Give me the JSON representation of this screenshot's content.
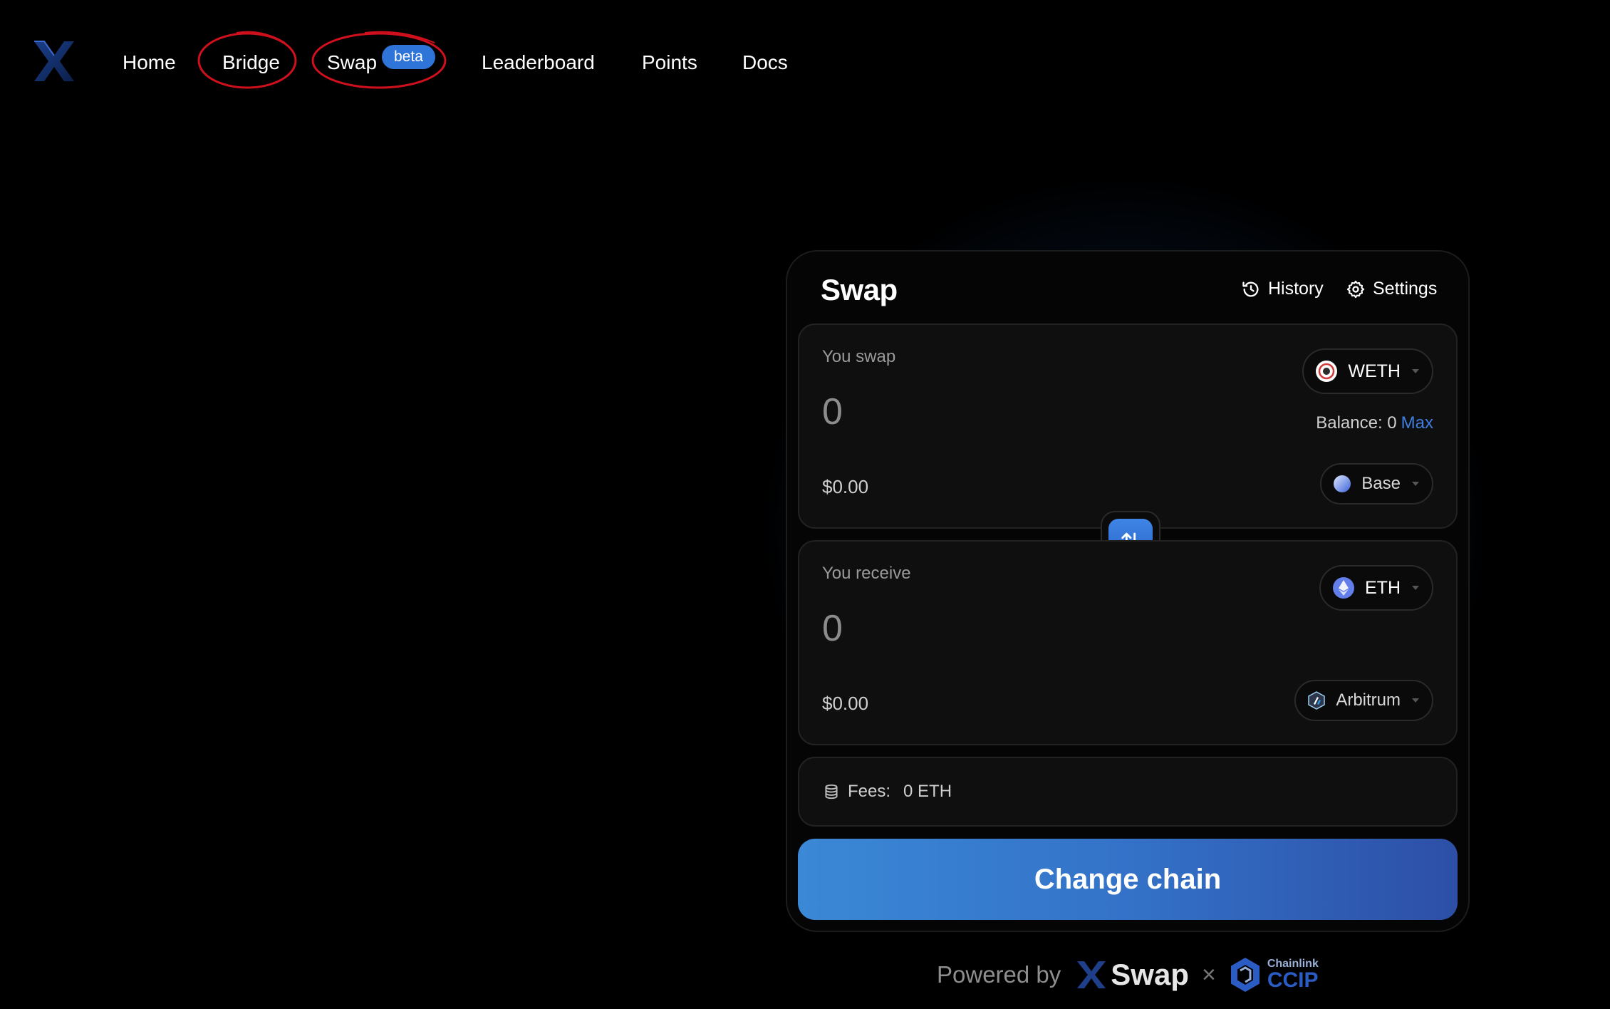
{
  "nav": {
    "items": [
      {
        "label": "Home"
      },
      {
        "label": "Bridge"
      },
      {
        "label": "Swap"
      },
      {
        "label": "Leaderboard"
      },
      {
        "label": "Points"
      },
      {
        "label": "Docs"
      }
    ],
    "beta_badge": "beta"
  },
  "card": {
    "title": "Swap",
    "history_label": "History",
    "settings_label": "Settings"
  },
  "from": {
    "label": "You swap",
    "amount_placeholder": "0",
    "usd_value": "$0.00",
    "token": "WETH",
    "network": "Base",
    "balance_label": "Balance: 0",
    "max_label": "Max"
  },
  "to": {
    "label": "You receive",
    "amount_placeholder": "0",
    "usd_value": "$0.00",
    "token": "ETH",
    "network": "Arbitrum"
  },
  "fees": {
    "label": "Fees:",
    "value": "0 ETH"
  },
  "cta_label": "Change chain",
  "footer": {
    "powered_by": "Powered by",
    "brand": "Swap",
    "separator": "×",
    "partner_small": "Chainlink",
    "partner_big": "CCIP"
  },
  "colors": {
    "accent": "#3f7fe0",
    "annotation": "#d0101c",
    "cta_start": "#3b88d6",
    "cta_end": "#2d4fa6"
  }
}
